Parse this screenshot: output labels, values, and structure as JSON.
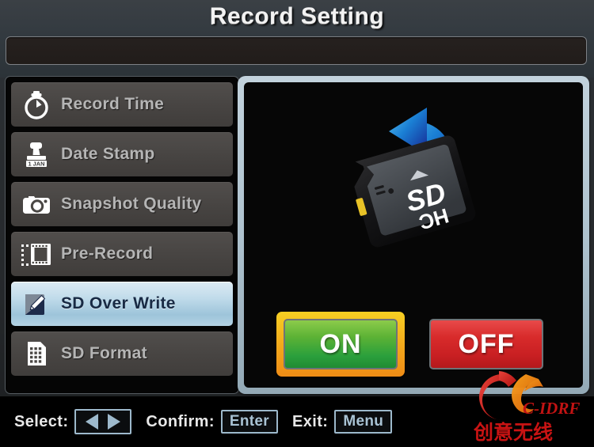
{
  "header": {
    "title": "Record Setting",
    "info_bar_text": ""
  },
  "colors": {
    "accent_selected": "#b4d3e4",
    "highlight_frame": "#f3a91b",
    "on_green": "#2ba03c",
    "off_red": "#c81f22",
    "panel_border": "#aec2ce",
    "menu_item_bg": "#474442",
    "menu_text": "#b5b5b5",
    "selected_text": "#182a44"
  },
  "menu": {
    "items": [
      {
        "label": "Record Time",
        "icon": "stopwatch-icon",
        "selected": false
      },
      {
        "label": "Date Stamp",
        "icon": "date-stamp-icon",
        "selected": false
      },
      {
        "label": "Snapshot Quality",
        "icon": "camera-icon",
        "selected": false
      },
      {
        "label": "Pre-Record",
        "icon": "film-strip-icon",
        "selected": false
      },
      {
        "label": "SD Over Write",
        "icon": "sd-overwrite-pencil-icon",
        "selected": true
      },
      {
        "label": "SD Format",
        "icon": "sd-format-grid-icon",
        "selected": false
      }
    ]
  },
  "preview": {
    "illustration": "sd-card-overwrite-icon",
    "sd_card_label": "SD",
    "sd_card_sublabel": "HC",
    "options": [
      {
        "label": "ON",
        "value": "on",
        "selected": true
      },
      {
        "label": "OFF",
        "value": "off",
        "selected": false
      }
    ]
  },
  "footer": {
    "select_label": "Select:",
    "confirm_label": "Confirm:",
    "confirm_key": "Enter",
    "exit_label": "Exit:",
    "exit_key": "Menu",
    "left_arrow": "left-arrow-icon",
    "right_arrow": "right-arrow-icon"
  },
  "watermark": {
    "brand_latin": "C-IDRF",
    "brand_cjk": "创意无线"
  }
}
